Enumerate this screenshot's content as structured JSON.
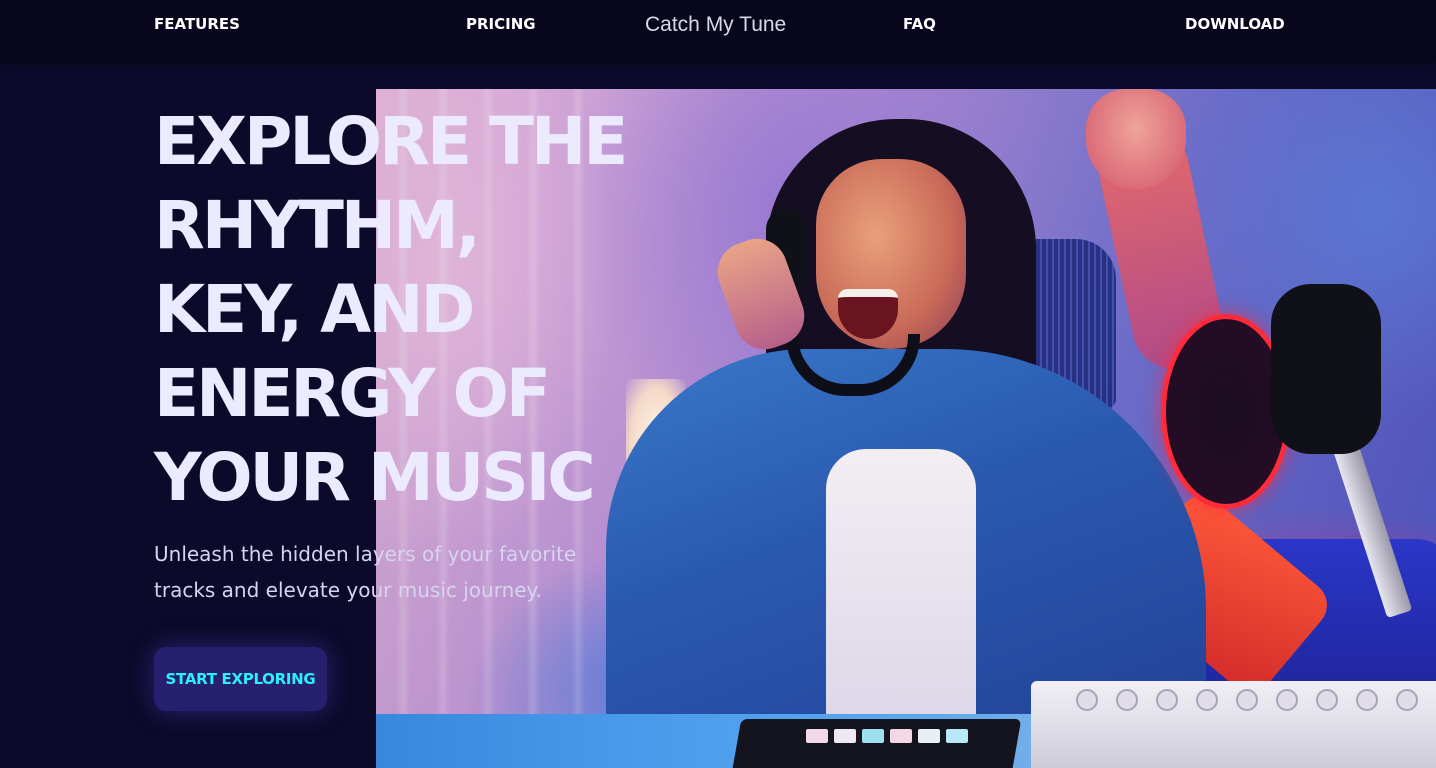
{
  "nav": {
    "features_label": "FEATURES",
    "pricing_label": "PRICING",
    "brand": "Catch My Tune",
    "faq_label": "FAQ",
    "download_label": "DOWNLOAD"
  },
  "hero": {
    "title_lines": [
      "EXPLORE THE",
      "RHYTHM,",
      "KEY, AND",
      "ENERGY OF",
      "YOUR MUSIC"
    ],
    "subtitle": "Unleash the hidden layers of your favorite tracks and elevate your music journey.",
    "cta_label": "START EXPLORING",
    "image": "woman-with-headphones-music-studio-photo"
  },
  "colors": {
    "background": "#0b0a2a",
    "navbar": "#07061c",
    "title_text": "#eceaff",
    "cta_background": "#26206e",
    "cta_text": "#2cf0ff"
  }
}
